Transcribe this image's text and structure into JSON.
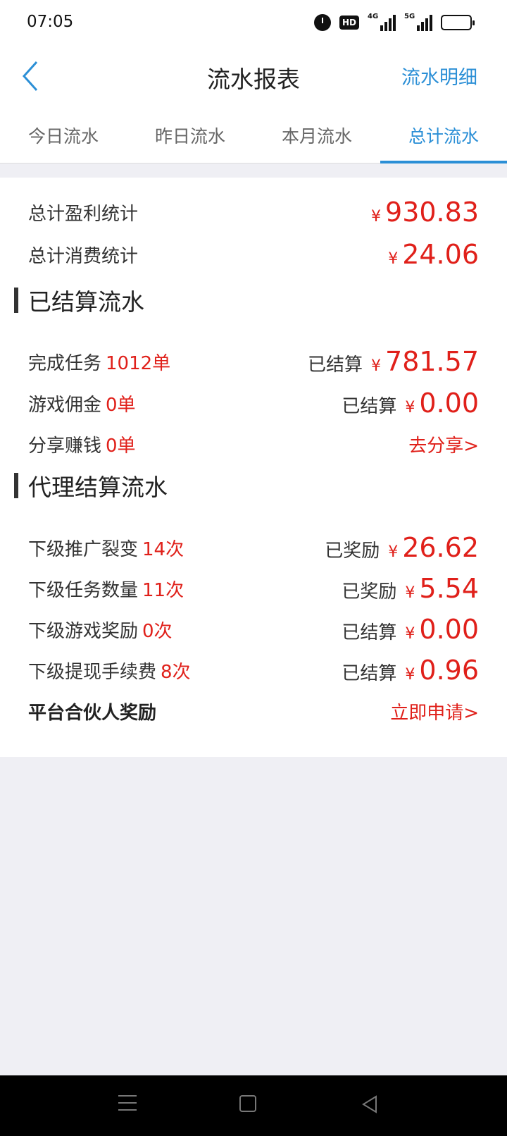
{
  "status_bar": {
    "time": "07:05",
    "icons": [
      "alarm-icon",
      "hd-icon",
      "signal-4g-icon",
      "signal-5g-icon",
      "battery-icon"
    ],
    "hd_label": "HD",
    "sig1_label": "4G",
    "sig2_label": "5G"
  },
  "header": {
    "title": "流水报表",
    "right_link": "流水明细"
  },
  "tabs": [
    {
      "label": "今日流水"
    },
    {
      "label": "昨日流水"
    },
    {
      "label": "本月流水"
    },
    {
      "label": "总计流水"
    }
  ],
  "summary": {
    "profit_label": "总计盈利统计",
    "profit_yen": "¥",
    "profit_value": "930.83",
    "consume_label": "总计消费统计",
    "consume_yen": "¥",
    "consume_value": "24.06"
  },
  "settled": {
    "title": "已结算流水",
    "rows": [
      {
        "label": "完成任务",
        "count": "1012单",
        "status": "已结算",
        "yen": "¥",
        "amount": "781.57"
      },
      {
        "label": "游戏佣金",
        "count": "0单",
        "status": "已结算",
        "yen": "¥",
        "amount": "0.00"
      },
      {
        "label": "分享赚钱",
        "count": "0单",
        "link": "去分享>"
      }
    ]
  },
  "agent": {
    "title": "代理结算流水",
    "rows": [
      {
        "label": "下级推广裂变",
        "count": "14次",
        "status": "已奖励",
        "yen": "¥",
        "amount": "26.62"
      },
      {
        "label": "下级任务数量",
        "count": "11次",
        "status": "已奖励",
        "yen": "¥",
        "amount": "5.54"
      },
      {
        "label": "下级游戏奖励",
        "count": "0次",
        "status": "已结算",
        "yen": "¥",
        "amount": "0.00"
      },
      {
        "label": "下级提现手续费",
        "count": "8次",
        "status": "已结算",
        "yen": "¥",
        "amount": "0.96"
      }
    ],
    "partner_label": "平台合伙人奖励",
    "partner_link": "立即申请>"
  },
  "colors": {
    "accent_blue": "#2b8fd6",
    "accent_red": "#e0201a",
    "background": "#efeff4"
  }
}
